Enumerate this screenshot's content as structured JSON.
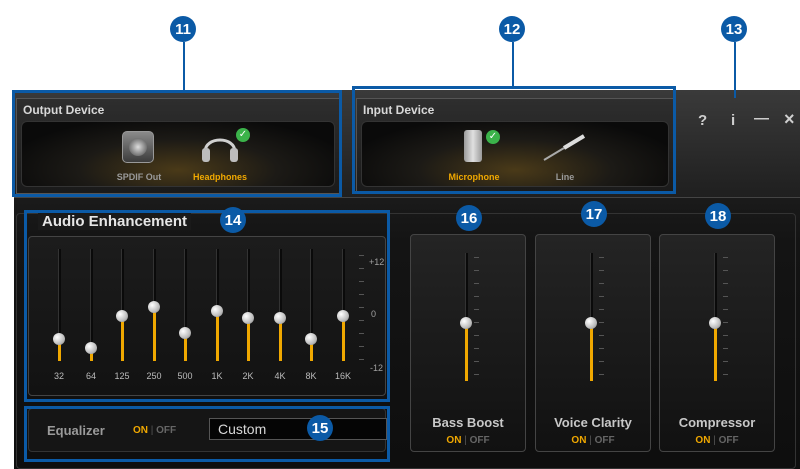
{
  "callouts": [
    "11",
    "12",
    "13",
    "14",
    "15",
    "16",
    "17",
    "18"
  ],
  "output_device": {
    "title": "Output Device",
    "devices": [
      {
        "label": "SPDIF Out",
        "icon": "spdif-icon",
        "selected": false
      },
      {
        "label": "Headphones",
        "icon": "headphones-icon",
        "selected": true
      }
    ]
  },
  "input_device": {
    "title": "Input Device",
    "devices": [
      {
        "label": "Microphone",
        "icon": "microphone-icon",
        "selected": true
      },
      {
        "label": "Line",
        "icon": "line-cable-icon",
        "selected": false
      }
    ]
  },
  "window_controls": {
    "help": "?",
    "info": "i",
    "minimize": "—",
    "close": "×"
  },
  "audio_enhancement": {
    "title": "Audio Enhancement",
    "db_labels": {
      "top": "+12",
      "mid": "0",
      "bottom": "-12"
    },
    "bands": [
      {
        "freq": "32",
        "level": 0.2
      },
      {
        "freq": "64",
        "level": 0.12
      },
      {
        "freq": "125",
        "level": 0.4
      },
      {
        "freq": "250",
        "level": 0.48
      },
      {
        "freq": "500",
        "level": 0.25
      },
      {
        "freq": "1K",
        "level": 0.45
      },
      {
        "freq": "2K",
        "level": 0.38
      },
      {
        "freq": "4K",
        "level": 0.38
      },
      {
        "freq": "8K",
        "level": 0.2
      },
      {
        "freq": "16K",
        "level": 0.4
      }
    ]
  },
  "equalizer": {
    "label": "Equalizer",
    "on": "ON",
    "off": "OFF",
    "preset": "Custom",
    "state": "on"
  },
  "effects": [
    {
      "name": "Bass Boost",
      "on": "ON",
      "off": "OFF",
      "level": 0.45,
      "state": "on"
    },
    {
      "name": "Voice Clarity",
      "on": "ON",
      "off": "OFF",
      "level": 0.45,
      "state": "on"
    },
    {
      "name": "Compressor",
      "on": "ON",
      "off": "OFF",
      "level": 0.45,
      "state": "on"
    }
  ],
  "colors": {
    "accent": "#f0a800",
    "callout": "#0b5aa6",
    "check": "#3bb34a"
  }
}
